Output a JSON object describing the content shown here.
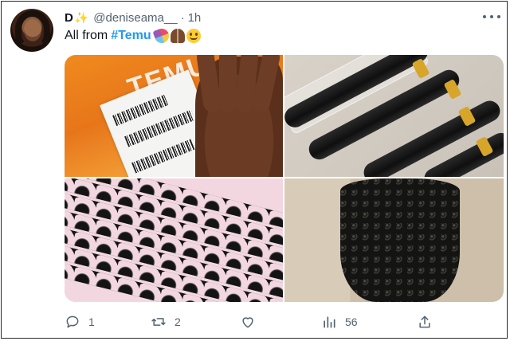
{
  "tweet": {
    "display_name": "D",
    "badge_emoji": "✨",
    "handle": "@deniseama__",
    "separator": "·",
    "time": "1h",
    "text_prefix": "All from",
    "hashtag": "#Temu",
    "emojis": [
      "party-popper",
      "folded-hands",
      "slightly-smiling-face"
    ],
    "package_text": "TEMU"
  },
  "media": [
    {
      "name": "temu-package-photo"
    },
    {
      "name": "hair-bundles-photo"
    },
    {
      "name": "eyelashes-tray-photo"
    },
    {
      "name": "curly-hair-photo"
    }
  ],
  "actions": {
    "reply_count": "1",
    "retweet_count": "2",
    "like_count": "",
    "views_count": "56"
  },
  "colors": {
    "link": "#1d9bf0",
    "text": "#0f1419",
    "muted": "#536471"
  }
}
